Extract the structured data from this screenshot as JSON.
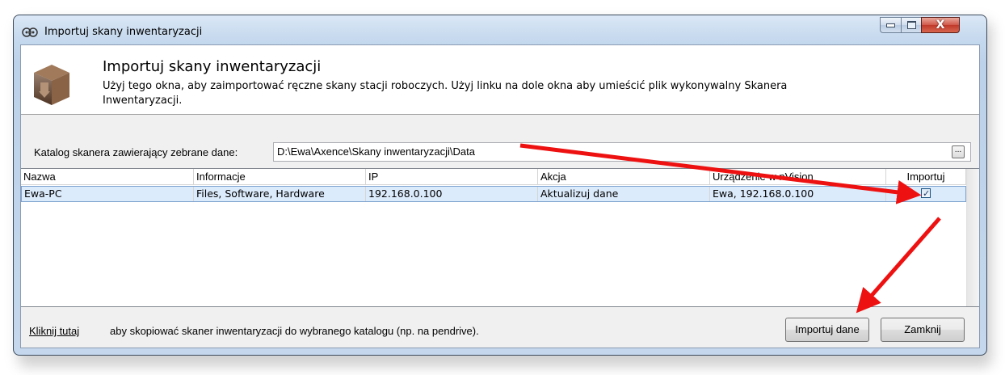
{
  "window": {
    "title": "Importuj skany inwentaryzacji",
    "close_glyph": "X"
  },
  "header": {
    "title": "Importuj skany inwentaryzacji",
    "description": "Użyj tego okna, aby zaimportować ręczne skany stacji roboczych. Użyj linku na dole okna aby umieścić plik wykonywalny Skanera Inwentaryzacji."
  },
  "directory": {
    "label": "Katalog skanera zawierający zebrane dane:",
    "value": "D:\\Ewa\\Axence\\Skany inwentaryzacji\\Data",
    "browse_label": "..."
  },
  "table": {
    "columns": [
      "Nazwa",
      "Informacje",
      "IP",
      "Akcja",
      "Urządzenie w nVision",
      "Importuj"
    ],
    "rows": [
      {
        "nazwa": "Ewa-PC",
        "informacje": "Files, Software, Hardware",
        "ip": "192.168.0.100",
        "akcja": "Aktualizuj dane",
        "urzadzenie": "Ewa, 192.168.0.100",
        "importuj": true
      }
    ]
  },
  "footer": {
    "link_text": "Kliknij tutaj",
    "text": "aby skopiować skaner inwentaryzacji do wybranego katalogu (np. na pendrive).",
    "import_button": "Importuj dane",
    "close_button": "Zamknij"
  },
  "colors": {
    "annotation_arrow": "#ee1111",
    "selection_row": "#dcebfc"
  }
}
